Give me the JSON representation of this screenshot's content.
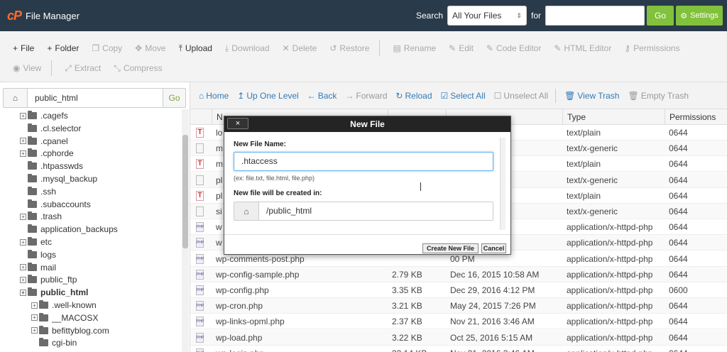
{
  "app": {
    "logo": "cP",
    "title": "File Manager"
  },
  "search": {
    "label": "Search",
    "scope": "All Your Files",
    "for_label": "for",
    "query": "",
    "go": "Go",
    "settings": "Settings"
  },
  "toolbar": {
    "row1": [
      {
        "icon": "plus-icon",
        "glyph": "+",
        "label": "File",
        "active": true
      },
      {
        "icon": "plus-icon",
        "glyph": "+",
        "label": "Folder",
        "active": true
      },
      {
        "icon": "copy-icon",
        "glyph": "❐",
        "label": "Copy",
        "active": false
      },
      {
        "icon": "move-icon",
        "glyph": "✥",
        "label": "Move",
        "active": false
      },
      {
        "icon": "upload-icon",
        "glyph": "⤒",
        "label": "Upload",
        "active": true
      },
      {
        "icon": "download-icon",
        "glyph": "⤓",
        "label": "Download",
        "active": false
      },
      {
        "icon": "delete-icon",
        "glyph": "✕",
        "label": "Delete",
        "active": false
      },
      {
        "icon": "restore-icon",
        "glyph": "↺",
        "label": "Restore",
        "active": false
      },
      {
        "icon": "rename-icon",
        "glyph": "▤",
        "label": "Rename",
        "active": false
      },
      {
        "icon": "edit-icon",
        "glyph": "✎",
        "label": "Edit",
        "active": false
      },
      {
        "icon": "code-editor-icon",
        "glyph": "✎",
        "label": "Code Editor",
        "active": false
      },
      {
        "icon": "html-editor-icon",
        "glyph": "✎",
        "label": "HTML Editor",
        "active": false
      },
      {
        "icon": "key-icon",
        "glyph": "⚷",
        "label": "Permissions",
        "active": false
      }
    ],
    "row2": [
      {
        "icon": "eye-icon",
        "glyph": "◉",
        "label": "View",
        "active": false
      },
      {
        "icon": "extract-icon",
        "glyph": "⤢",
        "label": "Extract",
        "active": false
      },
      {
        "icon": "compress-icon",
        "glyph": "⤡",
        "label": "Compress",
        "active": false
      }
    ]
  },
  "sidebar": {
    "path": "public_html",
    "go": "Go",
    "tree": [
      {
        "label": ".cagefs",
        "indent": 0,
        "plus": true
      },
      {
        "label": ".cl.selector",
        "indent": 0,
        "plus": false
      },
      {
        "label": ".cpanel",
        "indent": 0,
        "plus": true
      },
      {
        "label": ".cphorde",
        "indent": 0,
        "plus": true
      },
      {
        "label": ".htpasswds",
        "indent": 0,
        "plus": false
      },
      {
        "label": ".mysql_backup",
        "indent": 0,
        "plus": false
      },
      {
        "label": ".ssh",
        "indent": 0,
        "plus": false
      },
      {
        "label": ".subaccounts",
        "indent": 0,
        "plus": false
      },
      {
        "label": ".trash",
        "indent": 0,
        "plus": true
      },
      {
        "label": "application_backups",
        "indent": 0,
        "plus": false
      },
      {
        "label": "etc",
        "indent": 0,
        "plus": true
      },
      {
        "label": "logs",
        "indent": 0,
        "plus": false
      },
      {
        "label": "mail",
        "indent": 0,
        "plus": true
      },
      {
        "label": "public_ftp",
        "indent": 0,
        "plus": true
      },
      {
        "label": "public_html",
        "indent": 0,
        "plus": true,
        "bold": true
      },
      {
        "label": ".well-known",
        "indent": 1,
        "plus": true
      },
      {
        "label": "__MACOSX",
        "indent": 1,
        "plus": true
      },
      {
        "label": "befittyblog.com",
        "indent": 1,
        "plus": true
      },
      {
        "label": "cgi-bin",
        "indent": 1,
        "plus": false
      }
    ]
  },
  "nav": [
    {
      "icon": "home-icon",
      "glyph": "⌂",
      "label": "Home",
      "disabled": false
    },
    {
      "icon": "up-level-icon",
      "glyph": "↥",
      "label": "Up One Level",
      "disabled": false
    },
    {
      "icon": "back-icon",
      "glyph": "←",
      "label": "Back",
      "disabled": false
    },
    {
      "icon": "forward-icon",
      "glyph": "→",
      "label": "Forward",
      "disabled": true
    },
    {
      "icon": "reload-icon",
      "glyph": "↻",
      "label": "Reload",
      "disabled": false
    },
    {
      "icon": "select-all-icon",
      "glyph": "☑",
      "label": "Select All",
      "disabled": false
    },
    {
      "icon": "unselect-all-icon",
      "glyph": "☐",
      "label": "Unselect All",
      "disabled": true
    },
    {
      "icon": "trash-icon",
      "glyph": "🗑",
      "label": "View Trash",
      "disabled": false
    },
    {
      "icon": "trash-icon",
      "glyph": "🗑",
      "label": "Empty Trash",
      "disabled": true
    }
  ],
  "table": {
    "headers": [
      "N",
      "",
      "",
      "Type",
      "Permissions"
    ],
    "rows": [
      {
        "icon": "t",
        "name": "lo",
        "size": "",
        "modified": "PM",
        "type": "text/plain",
        "perm": "0644"
      },
      {
        "icon": "g",
        "name": "m",
        "size": "",
        "modified": "56 PM",
        "type": "text/x-generic",
        "perm": "0644"
      },
      {
        "icon": "t",
        "name": "m",
        "size": "",
        "modified": "15 PM",
        "type": "text/plain",
        "perm": "0644"
      },
      {
        "icon": "g",
        "name": "pl",
        "size": "",
        "modified": "7 PM",
        "type": "text/x-generic",
        "perm": "0644"
      },
      {
        "icon": "t",
        "name": "pl",
        "size": "",
        "modified": "16 PM",
        "type": "text/plain",
        "perm": "0644"
      },
      {
        "icon": "g",
        "name": "si",
        "size": "",
        "modified": "03 PM",
        "type": "text/x-generic",
        "perm": "0644"
      },
      {
        "icon": "php",
        "name": "w",
        "size": "",
        "modified": "36 PM",
        "type": "application/x-httpd-php",
        "perm": "0644"
      },
      {
        "icon": "php",
        "name": "w",
        "size": "",
        "modified": "20 PM",
        "type": "application/x-httpd-php",
        "perm": "0644"
      },
      {
        "icon": "php",
        "name": "wp-comments-post.php",
        "size": "",
        "modified": "00 PM",
        "type": "application/x-httpd-php",
        "perm": "0644"
      },
      {
        "icon": "php",
        "name": "wp-config-sample.php",
        "size": "2.79 KB",
        "modified": "Dec 16, 2015 10:58 AM",
        "type": "application/x-httpd-php",
        "perm": "0644"
      },
      {
        "icon": "php",
        "name": "wp-config.php",
        "size": "3.35 KB",
        "modified": "Dec 29, 2016 4:12 PM",
        "type": "application/x-httpd-php",
        "perm": "0600"
      },
      {
        "icon": "php",
        "name": "wp-cron.php",
        "size": "3.21 KB",
        "modified": "May 24, 2015 7:26 PM",
        "type": "application/x-httpd-php",
        "perm": "0644"
      },
      {
        "icon": "php",
        "name": "wp-links-opml.php",
        "size": "2.37 KB",
        "modified": "Nov 21, 2016 3:46 AM",
        "type": "application/x-httpd-php",
        "perm": "0644"
      },
      {
        "icon": "php",
        "name": "wp-load.php",
        "size": "3.22 KB",
        "modified": "Oct 25, 2016 5:15 AM",
        "type": "application/x-httpd-php",
        "perm": "0644"
      },
      {
        "icon": "php",
        "name": "wp-login.php",
        "size": "33.14 KB",
        "modified": "Nov 21, 2016 3:46 AM",
        "type": "application/x-httpd-php",
        "perm": "0644"
      }
    ]
  },
  "modal": {
    "title": "New File",
    "close": "×",
    "name_label": "New File Name:",
    "name_value": ".htaccess",
    "hint": "(ex: file.txt, file.html, file.php)",
    "path_label": "New file will be created in:",
    "path_value": "/public_html",
    "create": "Create New File",
    "cancel": "Cancel"
  }
}
